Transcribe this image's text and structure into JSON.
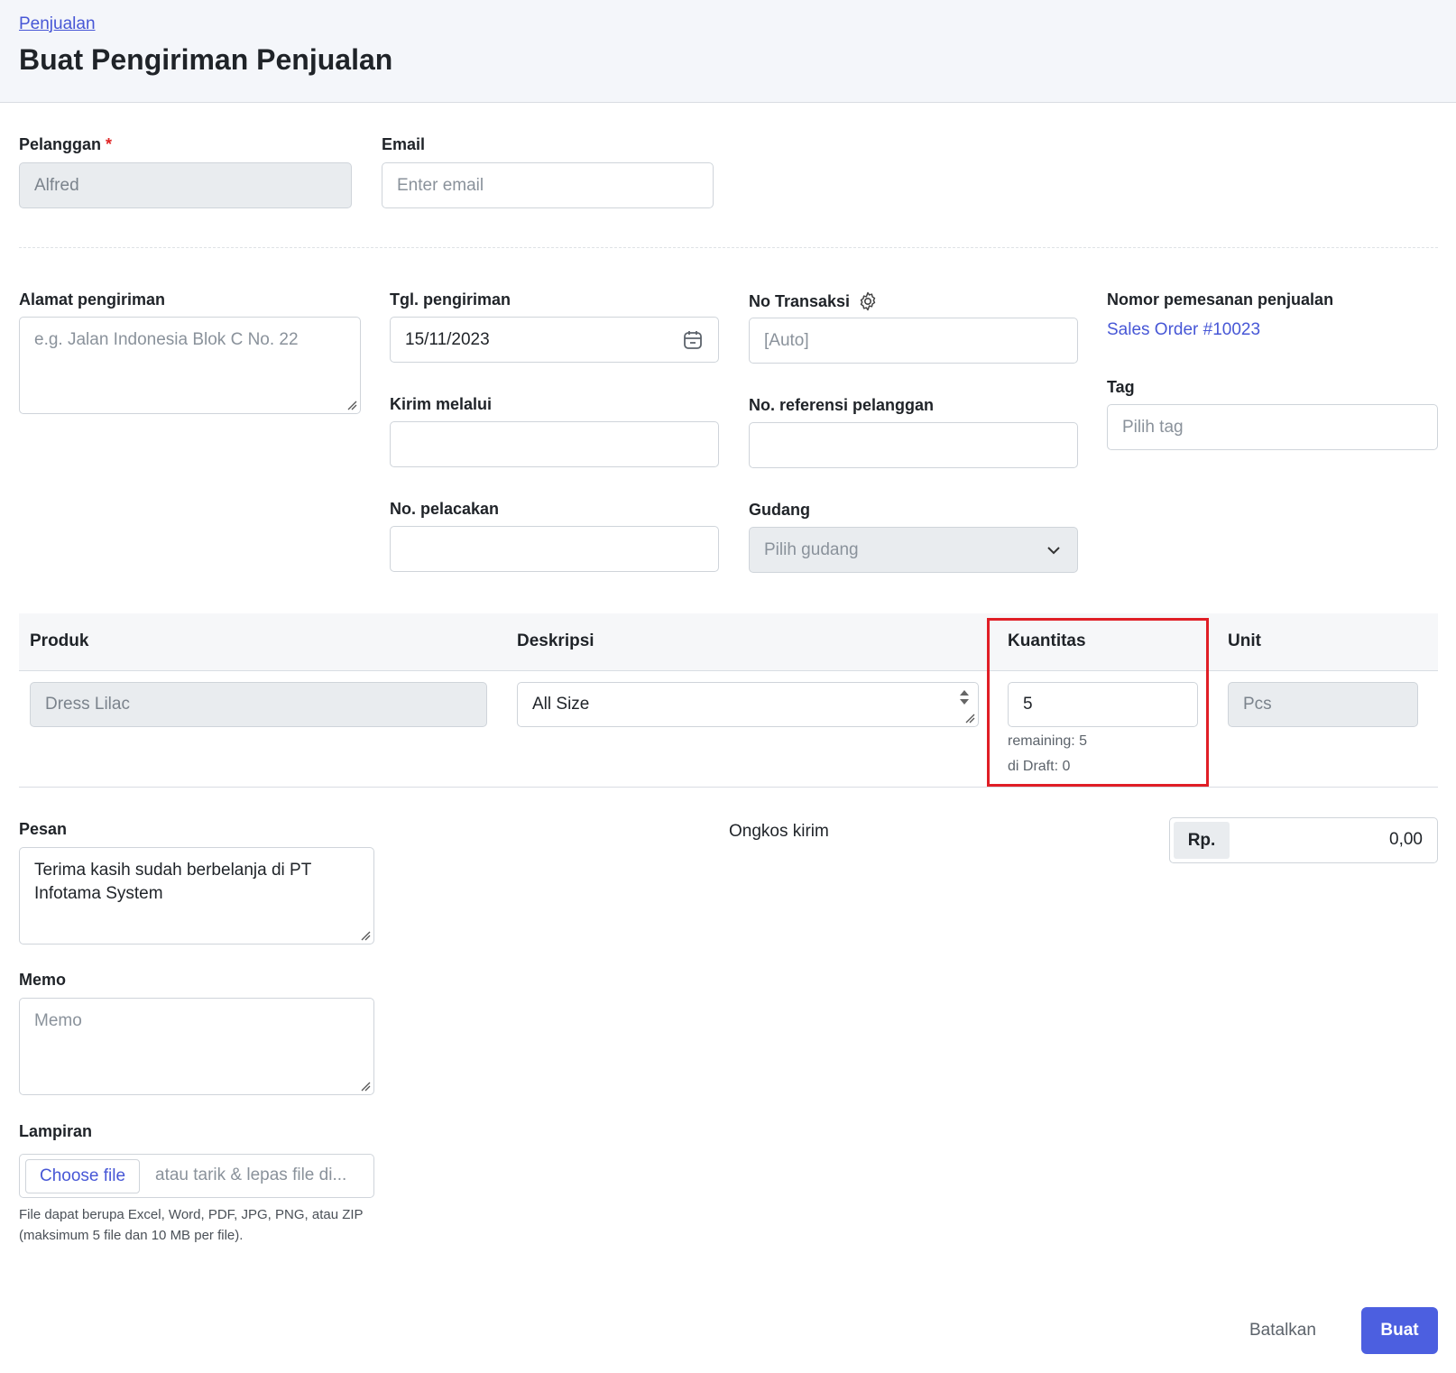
{
  "header": {
    "breadcrumb": "Penjualan",
    "title": "Buat Pengiriman Penjualan"
  },
  "customer": {
    "label": "Pelanggan",
    "required_mark": "*",
    "value": "Alfred"
  },
  "email": {
    "label": "Email",
    "placeholder": "Enter email"
  },
  "shipping_address": {
    "label": "Alamat pengiriman",
    "placeholder": "e.g. Jalan Indonesia Blok C No. 22"
  },
  "ship_date": {
    "label": "Tgl. pengiriman",
    "value": "15/11/2023"
  },
  "transaction_no": {
    "label": "No Transaksi",
    "placeholder": "[Auto]"
  },
  "sales_order": {
    "label": "Nomor pemesanan penjualan",
    "link": "Sales Order #10023"
  },
  "ship_via": {
    "label": "Kirim melalui",
    "value": ""
  },
  "customer_ref": {
    "label": "No. referensi pelanggan",
    "value": ""
  },
  "tag": {
    "label": "Tag",
    "placeholder": "Pilih tag"
  },
  "tracking_no": {
    "label": "No. pelacakan",
    "value": ""
  },
  "warehouse": {
    "label": "Gudang",
    "placeholder": "Pilih gudang"
  },
  "table": {
    "headers": {
      "product": "Produk",
      "description": "Deskripsi",
      "quantity": "Kuantitas",
      "unit": "Unit"
    },
    "row": {
      "product": "Dress Lilac",
      "description": "All Size",
      "quantity": "5",
      "unit": "Pcs",
      "remaining": "remaining: 5",
      "draft": "di Draft: 0"
    }
  },
  "message": {
    "label": "Pesan",
    "value": "Terima kasih sudah berbelanja di PT Infotama System"
  },
  "shipping_cost": {
    "label": "Ongkos kirim",
    "currency": "Rp.",
    "value": "0,00"
  },
  "memo": {
    "label": "Memo",
    "placeholder": "Memo"
  },
  "attachment": {
    "label": "Lampiran",
    "button": "Choose file",
    "drop_text": "atau tarik & lepas file di...",
    "help_line1": "File dapat berupa Excel, Word, PDF, JPG, PNG, atau ZIP",
    "help_line2": "(maksimum 5 file dan 10 MB per file)."
  },
  "actions": {
    "cancel": "Batalkan",
    "submit": "Buat"
  },
  "colors": {
    "accent": "#4c5fe0",
    "link": "#4757d6",
    "highlight": "#e01e26"
  }
}
